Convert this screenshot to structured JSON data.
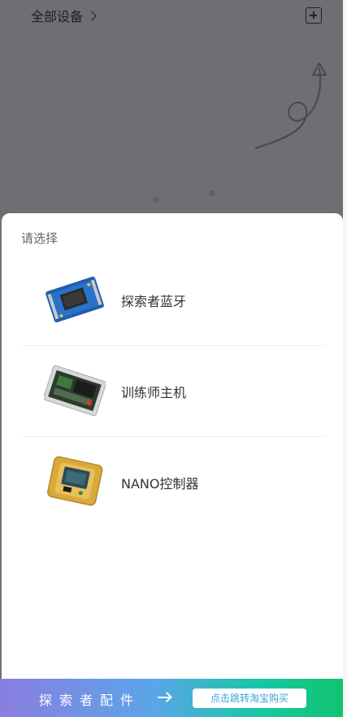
{
  "header": {
    "title": "全部设备"
  },
  "sheet": {
    "title": "请选择",
    "items": [
      {
        "label": "探索者蓝牙",
        "icon": "bluetooth-module-icon"
      },
      {
        "label": "训练师主机",
        "icon": "trainer-host-icon"
      },
      {
        "label": "NANO控制器",
        "icon": "nano-controller-icon"
      }
    ]
  },
  "footer": {
    "text": "探索者配件",
    "button_label": "点击跳转淘宝购买"
  }
}
